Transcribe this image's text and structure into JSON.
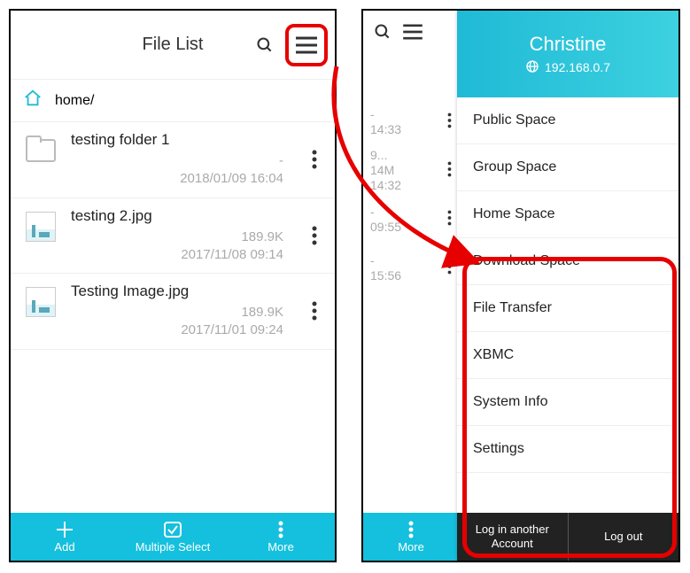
{
  "left": {
    "title": "File List",
    "breadcrumb": "home/",
    "files": [
      {
        "name": "testing folder 1",
        "size": "-",
        "date": "2018/01/09 16:04"
      },
      {
        "name": "testing 2.jpg",
        "size": "189.9K",
        "date": "2017/11/08 09:14"
      },
      {
        "name": "Testing Image.jpg",
        "size": "189.9K",
        "date": "2017/11/01 09:24"
      }
    ],
    "bottom": {
      "add": "Add",
      "multi": "Multiple Select",
      "more": "More"
    }
  },
  "right": {
    "strip_rows": [
      {
        "lbl": "-",
        "sub": "14:33"
      },
      {
        "lbl": "9...\n14M",
        "sub": "14:32"
      },
      {
        "lbl": "-",
        "sub": "09:55"
      },
      {
        "lbl": "-",
        "sub": "15:56"
      }
    ],
    "strip_more": "More",
    "drawer": {
      "username": "Christine",
      "ip": "192.168.0.7",
      "items": [
        "Public Space",
        "Group Space",
        "Home Space",
        "Download Space",
        "File Transfer",
        "XBMC",
        "System Info",
        "Settings"
      ],
      "login_another": "Log in another Account",
      "logout": "Log out"
    }
  }
}
